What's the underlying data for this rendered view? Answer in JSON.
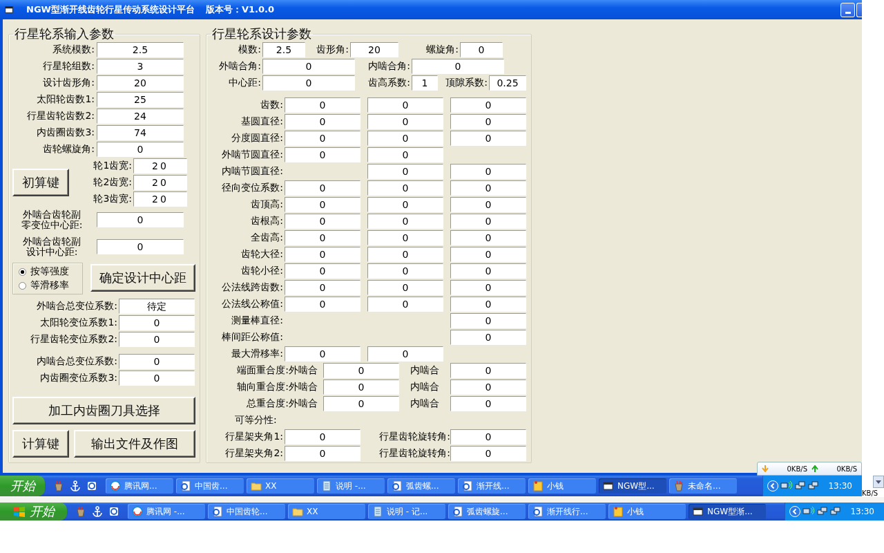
{
  "window": {
    "title": "NGW型渐开线齿轮行星传动系统设计平台",
    "version": "版本号：V1.0.0"
  },
  "input_group": {
    "title": "行星轮系输入参数",
    "fields": [
      {
        "label": "系统模数:",
        "value": "2.5"
      },
      {
        "label": "行星轮组数:",
        "value": "3"
      },
      {
        "label": "设计齿形角:",
        "value": "20"
      },
      {
        "label": "太阳轮齿数1:",
        "value": "25"
      },
      {
        "label": "行星齿轮齿数2:",
        "value": "24"
      },
      {
        "label": "内齿圈齿数3:",
        "value": "74"
      },
      {
        "label": "齿轮螺旋角:",
        "value": "0"
      }
    ],
    "init_button": "初算键",
    "width_fields": [
      {
        "label": "轮1齿宽:",
        "value": "20"
      },
      {
        "label": "轮2齿宽:",
        "value": "20"
      },
      {
        "label": "轮3齿宽:",
        "value": "20"
      }
    ],
    "center_distance_fields": [
      {
        "label_lines": [
          "外啮合齿轮副",
          "零变位中心距:"
        ],
        "value": "0"
      },
      {
        "label_lines": [
          "外啮合齿轮副",
          "设计中心距:"
        ],
        "value": "0"
      }
    ],
    "modes": [
      {
        "label": "按等强度",
        "selected": true
      },
      {
        "label": "等滑移率",
        "selected": false
      }
    ],
    "confirm_button": "确定设计中心距",
    "shift_fields": [
      {
        "label": "外啮合总变位系数:",
        "value": "待定"
      },
      {
        "label": "太阳轮变位系数1:",
        "value": "0"
      },
      {
        "label": "行星齿轮变位系数2:",
        "value": "0"
      }
    ],
    "inner_shift_fields": [
      {
        "label": "内啮合总变位系数:",
        "value": "0"
      },
      {
        "label": "内齿圈变位系数3:",
        "value": "0"
      }
    ],
    "tool_button": "加工内齿圈刀具选择",
    "calc_button": "计算键",
    "output_button": "输出文件及作图"
  },
  "design_group": {
    "title": "行星轮系设计参数",
    "header_rows": [
      [
        {
          "label": "模数:",
          "value": "2.5"
        },
        {
          "label": "齿形角:",
          "value": "20"
        },
        {
          "label": "螺旋角:",
          "value": "0"
        }
      ],
      [
        {
          "label": "外啮合角:",
          "value": "0"
        },
        {
          "label": "内啮合角:",
          "value": "0"
        }
      ],
      [
        {
          "label": "中心距:",
          "value": "0"
        },
        {
          "label": "齿高系数:",
          "value": "1"
        },
        {
          "label": "顶隙系数:",
          "value": "0.25"
        }
      ]
    ],
    "gear_rows": [
      {
        "label": "齿数:",
        "col_1": "0",
        "col_2": "0",
        "col_3": "0"
      },
      {
        "label": "基圆直径:",
        "col_1": "0",
        "col_2": "0",
        "col_3": "0"
      },
      {
        "label": "分度圆直径:",
        "col_1": "0",
        "col_2": "0",
        "col_3": "0"
      },
      {
        "label": "外啮节圆直径:",
        "col_1": "0",
        "col_2": "0"
      },
      {
        "label": "内啮节圆直径:",
        "col_2": "0",
        "col_3": "0"
      },
      {
        "label": "径向变位系数:",
        "col_1": "0",
        "col_2": "0",
        "col_3": "0"
      },
      {
        "label": "齿顶高:",
        "col_1": "0",
        "col_2": "0",
        "col_3": "0"
      },
      {
        "label": "齿根高:",
        "col_1": "0",
        "col_2": "0",
        "col_3": "0"
      },
      {
        "label": "全齿高:",
        "col_1": "0",
        "col_2": "0",
        "col_3": "0"
      },
      {
        "label": "齿轮大径:",
        "col_1": "0",
        "col_2": "0",
        "col_3": "0"
      },
      {
        "label": "齿轮小径:",
        "col_1": "0",
        "col_2": "0",
        "col_3": "0"
      },
      {
        "label": "公法线跨齿数:",
        "col_1": "0",
        "col_2": "0",
        "col_3": "0"
      },
      {
        "label": "公法线公称值:",
        "col_1": "0",
        "col_2": "0",
        "col_3": "0"
      },
      {
        "label": "测量棒直径:",
        "col_3": "0"
      },
      {
        "label": "棒间距公称值:",
        "col_3": "0"
      },
      {
        "label": "最大滑移率:",
        "col_1": "0",
        "col_2": "0"
      }
    ],
    "contact_ratio_rows": [
      {
        "label": "端面重合度:",
        "outer_label": "外啮合",
        "outer_value": "0",
        "inner_label": "内啮合",
        "inner_value": "0"
      },
      {
        "label": "轴向重合度:",
        "outer_label": "外啮合",
        "outer_value": "0",
        "inner_label": "内啮合",
        "inner_value": "0"
      },
      {
        "label": "总重合度:",
        "outer_label": "外啮合",
        "outer_value": "0",
        "inner_label": "内啮合",
        "inner_value": "0"
      }
    ],
    "divisibility_label": "可等分性:",
    "planet_rows": [
      {
        "label": "行星架夹角1:",
        "value": "0",
        "angle_label": "行星齿轮旋转角:",
        "angle_value": "0"
      },
      {
        "label": "行星架夹角2:",
        "value": "0",
        "angle_label": "行星齿轮旋转角:",
        "angle_value": "0"
      }
    ]
  },
  "net_meter": {
    "download": "0KB/S",
    "upload": "0KB/S",
    "fragment": "KB/S"
  },
  "taskbars": [
    {
      "start_label": "开始",
      "show_logo": false,
      "clock": "13:30",
      "items": [
        {
          "label": "腾讯网...",
          "kind": "web",
          "selected": false
        },
        {
          "label": "中国齿...",
          "kind": "doc",
          "selected": false
        },
        {
          "label": "XX",
          "kind": "folder",
          "selected": false
        },
        {
          "label": "说明 -...",
          "kind": "note",
          "selected": false
        },
        {
          "label": "弧齿螺...",
          "kind": "doc",
          "selected": false
        },
        {
          "label": "渐开线...",
          "kind": "doc",
          "selected": false
        },
        {
          "label": "小钱",
          "kind": "sticky",
          "selected": false
        },
        {
          "label": "NGW型...",
          "kind": "window",
          "selected": true
        },
        {
          "label": "未命名...",
          "kind": "paint",
          "selected": false
        }
      ]
    },
    {
      "start_label": "开始",
      "show_logo": true,
      "clock": "13:30",
      "items": [
        {
          "label": "腾讯网 -...",
          "kind": "web",
          "selected": false
        },
        {
          "label": "中国齿轮...",
          "kind": "doc",
          "selected": false
        },
        {
          "label": "XX",
          "kind": "folder",
          "selected": false
        },
        {
          "label": "说明 - 记...",
          "kind": "note",
          "selected": false
        },
        {
          "label": "弧齿螺旋...",
          "kind": "doc",
          "selected": false
        },
        {
          "label": "渐开线行...",
          "kind": "doc",
          "selected": false
        },
        {
          "label": "小钱",
          "kind": "sticky",
          "selected": false
        },
        {
          "label": "NGW型渐...",
          "kind": "window",
          "selected": true
        }
      ]
    }
  ]
}
